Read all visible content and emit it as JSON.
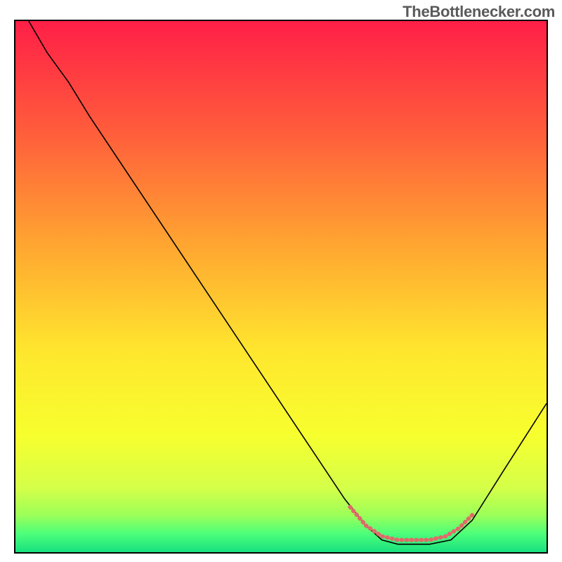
{
  "watermark": "TheBottlenecker.com",
  "chart_data": {
    "type": "line",
    "title": "",
    "xlabel": "",
    "ylabel": "",
    "xlim": [
      0,
      100
    ],
    "ylim": [
      0,
      100
    ],
    "gradient_stops": [
      {
        "offset": 0,
        "color": "#ff1f47"
      },
      {
        "offset": 0.2,
        "color": "#ff5a3c"
      },
      {
        "offset": 0.42,
        "color": "#ffa531"
      },
      {
        "offset": 0.62,
        "color": "#ffe62e"
      },
      {
        "offset": 0.78,
        "color": "#f7ff2e"
      },
      {
        "offset": 0.88,
        "color": "#d4ff49"
      },
      {
        "offset": 0.93,
        "color": "#9cff58"
      },
      {
        "offset": 0.965,
        "color": "#4dff7a"
      },
      {
        "offset": 1.0,
        "color": "#18e07f"
      }
    ],
    "series": [
      {
        "name": "bottleneck-curve",
        "color": "#000000",
        "width": 1.6,
        "points": [
          {
            "x": 2.5,
            "y": 100
          },
          {
            "x": 6,
            "y": 94
          },
          {
            "x": 10,
            "y": 88.5
          },
          {
            "x": 14,
            "y": 82
          },
          {
            "x": 28,
            "y": 61
          },
          {
            "x": 42,
            "y": 40
          },
          {
            "x": 56,
            "y": 19
          },
          {
            "x": 62,
            "y": 10
          },
          {
            "x": 66,
            "y": 5
          },
          {
            "x": 69,
            "y": 2.3
          },
          {
            "x": 72,
            "y": 1.5
          },
          {
            "x": 78,
            "y": 1.5
          },
          {
            "x": 82,
            "y": 2.3
          },
          {
            "x": 86,
            "y": 6
          },
          {
            "x": 92,
            "y": 15.5
          },
          {
            "x": 100,
            "y": 28
          }
        ]
      },
      {
        "name": "optimal-range-marker",
        "color": "#e16a6a",
        "width": 6,
        "dash": "1 6",
        "linecap": "round",
        "points": [
          {
            "x": 63,
            "y": 8.5
          },
          {
            "x": 66,
            "y": 5
          },
          {
            "x": 69,
            "y": 3
          },
          {
            "x": 72,
            "y": 2.3
          },
          {
            "x": 78,
            "y": 2.3
          },
          {
            "x": 81,
            "y": 3
          },
          {
            "x": 83.5,
            "y": 4.5
          },
          {
            "x": 86,
            "y": 7
          }
        ]
      }
    ]
  }
}
